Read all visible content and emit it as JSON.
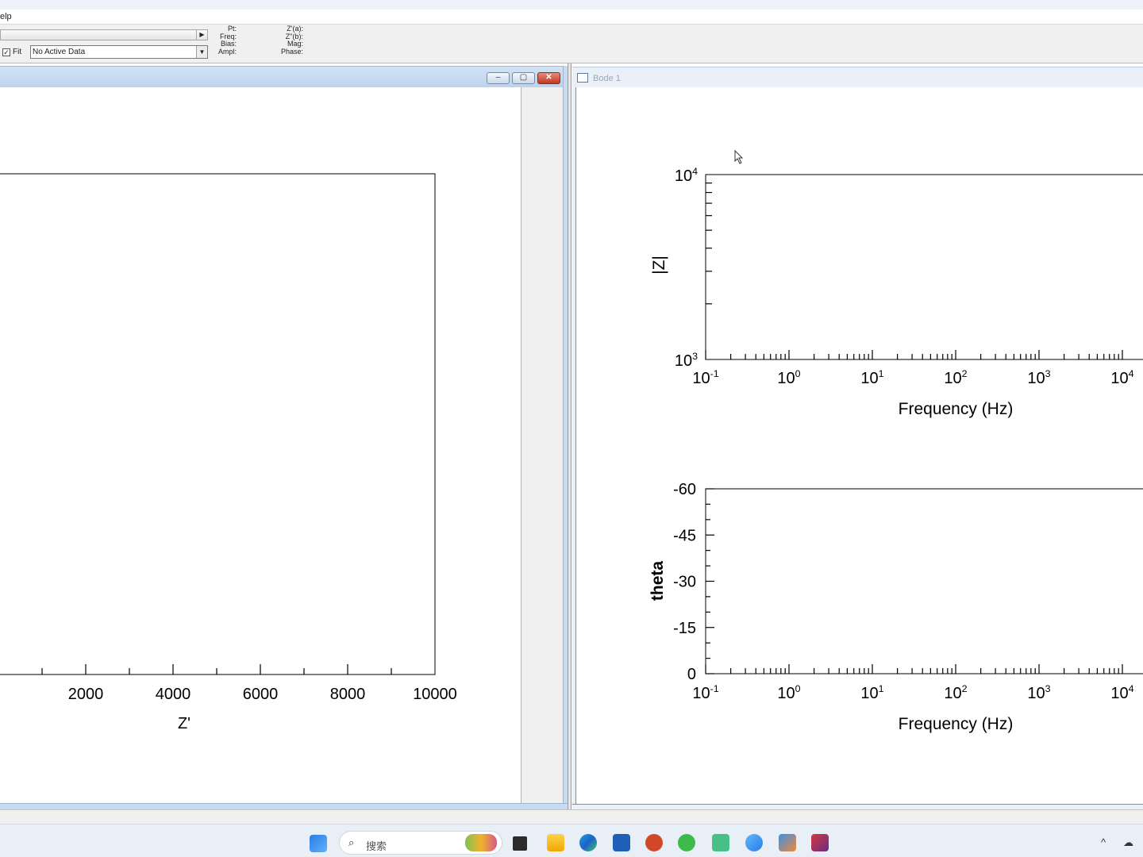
{
  "menubar": {
    "help_label": "elp"
  },
  "toolbar": {
    "fit_label": "Fit",
    "fit_checked": true,
    "active_data_value": "No Active Data",
    "info_left_labels": [
      "Pt:",
      "Freq:",
      "Bias:",
      "Ampl:"
    ],
    "info_right_labels": [
      "Z'(a):",
      "Z''(b):",
      "Mag:",
      "Phase:"
    ]
  },
  "windows": {
    "left_buttons": [
      "–",
      "▢",
      "✕"
    ],
    "right_title": "Bode 1"
  },
  "chart_data": [
    {
      "type": "scatter",
      "title": "",
      "xlabel": "Z'",
      "ylabel": "",
      "x_tick_labels": [
        "2000",
        "4000",
        "6000",
        "8000",
        "10000"
      ],
      "xlim": [
        0,
        10000
      ],
      "series": []
    },
    {
      "type": "line",
      "title": "",
      "xlabel": "Frequency (Hz)",
      "ylabel": "|Z|",
      "x_scale": "log",
      "y_scale": "log",
      "x_tick_labels": [
        "10^-1",
        "10^0",
        "10^1",
        "10^2",
        "10^3",
        "10^4"
      ],
      "y_tick_labels": [
        "10^4",
        "10^3"
      ],
      "ylim": [
        1000,
        10000
      ],
      "series": []
    },
    {
      "type": "line",
      "title": "",
      "xlabel": "Frequency (Hz)",
      "ylabel": "theta",
      "x_scale": "log",
      "x_tick_labels": [
        "10^-1",
        "10^0",
        "10^1",
        "10^2",
        "10^3",
        "10^4"
      ],
      "y_tick_labels": [
        "-60",
        "-45",
        "-30",
        "-15",
        "0"
      ],
      "ylim": [
        0,
        -60
      ],
      "series": []
    }
  ],
  "taskbar": {
    "search_placeholder": "搜索",
    "search_icon": "search-icon",
    "apps": [
      "start-icon",
      "task-view-icon",
      "file-explorer-icon",
      "edge-icon",
      "word-icon",
      "powerpoint-icon",
      "wechat-icon",
      "remote-desktop-icon",
      "photos-icon",
      "snipping-tool-icon",
      "zview-icon"
    ],
    "tray_items": [
      "^",
      "☁"
    ]
  }
}
